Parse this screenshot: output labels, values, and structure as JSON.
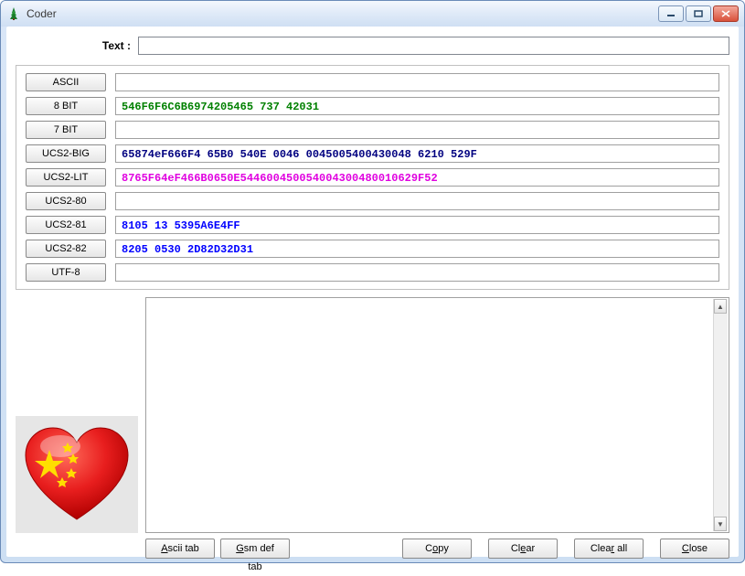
{
  "window": {
    "title": "Coder"
  },
  "labels": {
    "text": "Text :"
  },
  "text_input": {
    "value": ""
  },
  "encodings": [
    {
      "name": "ASCII",
      "value": "",
      "color": ""
    },
    {
      "name": "8 BIT",
      "value": "546F6F6C6B6974205465  737 42031",
      "color": "c-green"
    },
    {
      "name": "7 BIT",
      "value": "",
      "color": ""
    },
    {
      "name": "UCS2-BIG",
      "value": "65874eF666F4 65B0 540E 0046 0045005400430048 6210 529F",
      "color": "c-navy"
    },
    {
      "name": "UCS2-LIT",
      "value": "8765F64eF466B0650E544600450054004300480010629F52",
      "color": "c-magenta"
    },
    {
      "name": "UCS2-80",
      "value": "",
      "color": ""
    },
    {
      "name": "UCS2-81",
      "value": "8105 13  5395A6E4FF",
      "color": "c-blue"
    },
    {
      "name": "UCS2-82",
      "value": "8205 0530  2D82D32D31",
      "color": "c-blue"
    },
    {
      "name": "UTF-8",
      "value": "",
      "color": ""
    }
  ],
  "buttons": {
    "ascii_tab": "Ascii tab",
    "gsm_def_tab": "Gsm def tab",
    "copy": "Copy",
    "clear": "Clear",
    "clear_all": "Clear all",
    "close": "Close"
  },
  "icon": "heart-china-flag"
}
